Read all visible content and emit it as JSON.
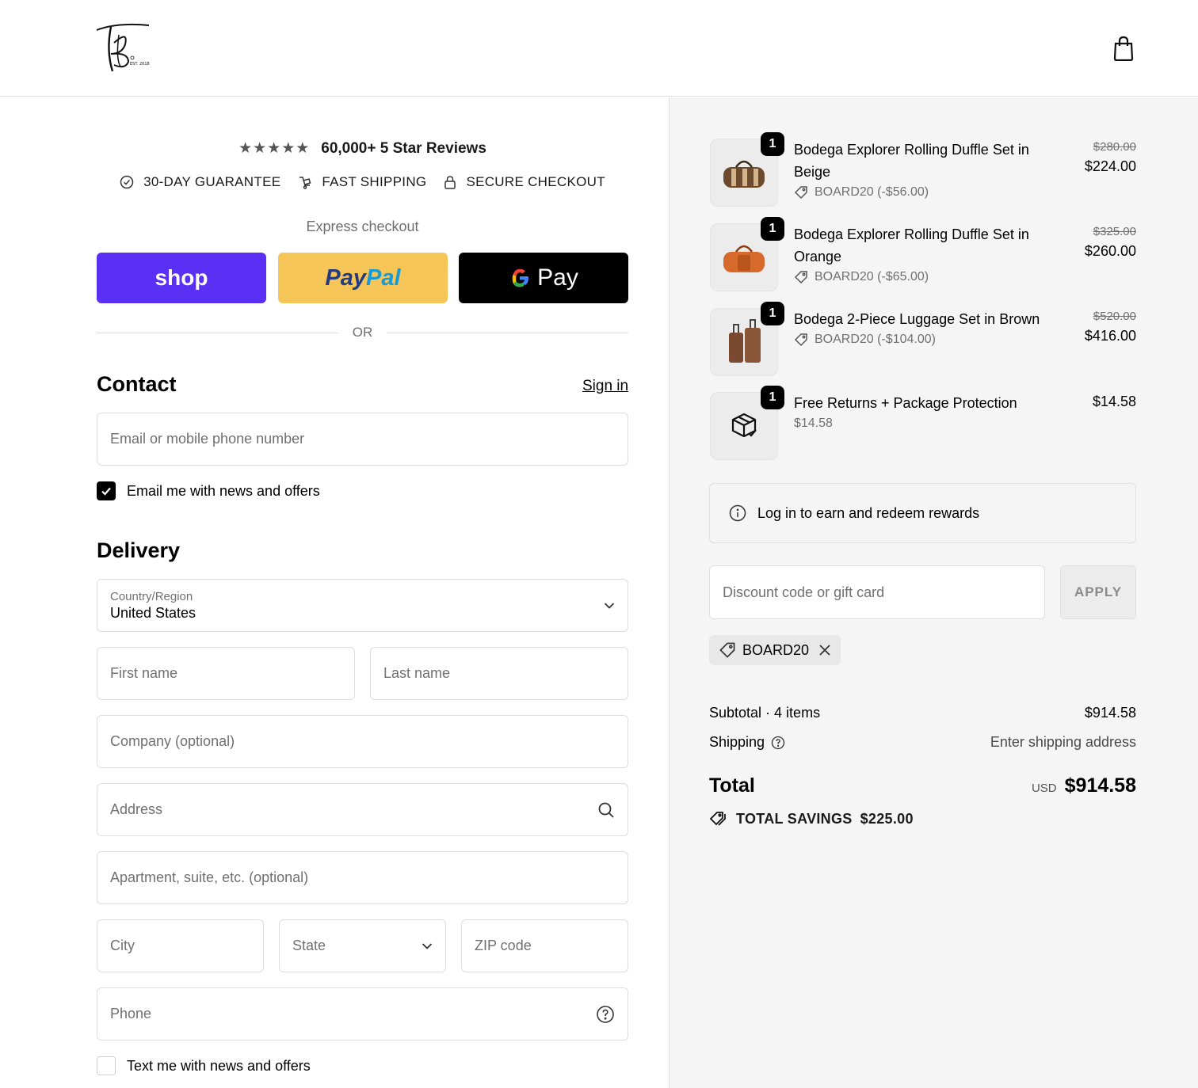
{
  "header": {
    "logo_alt": "TB EST. 2018",
    "cart_icon": "shopping-bag-icon"
  },
  "reviews": {
    "stars": "★★★★★",
    "text": "60,000+ 5 Star Reviews"
  },
  "trust": [
    {
      "icon": "check-circle-icon",
      "label": "30-DAY GUARANTEE"
    },
    {
      "icon": "shipping-icon",
      "label": "FAST SHIPPING"
    },
    {
      "icon": "lock-icon",
      "label": "SECURE CHECKOUT"
    }
  ],
  "express": {
    "title": "Express checkout",
    "shop_label": "shop",
    "paypal_label_1": "Pay",
    "paypal_label_2": "Pal",
    "gpay_label": "Pay",
    "or": "OR"
  },
  "contact": {
    "title": "Contact",
    "signin": "Sign in",
    "email_placeholder": "Email or mobile phone number",
    "email_news_label": "Email me with news and offers",
    "email_news_checked": true
  },
  "delivery": {
    "title": "Delivery",
    "country_label": "Country/Region",
    "country_value": "United States",
    "first_name": "First name",
    "last_name": "Last name",
    "company": "Company (optional)",
    "address": "Address",
    "apartment": "Apartment, suite, etc. (optional)",
    "city": "City",
    "state": "State",
    "zip": "ZIP code",
    "phone": "Phone",
    "text_news_label": "Text me with news and offers",
    "text_news_checked": false
  },
  "cart": {
    "items": [
      {
        "qty": "1",
        "name": "Bodega Explorer Rolling Duffle Set in Beige",
        "discount": "BOARD20 (-$56.00)",
        "old_price": "$280.00",
        "price": "$224.00"
      },
      {
        "qty": "1",
        "name": "Bodega Explorer Rolling Duffle Set in Orange",
        "discount": "BOARD20 (-$65.00)",
        "old_price": "$325.00",
        "price": "$260.00"
      },
      {
        "qty": "1",
        "name": "Bodega 2-Piece Luggage Set in Brown",
        "discount": "BOARD20 (-$104.00)",
        "old_price": "$520.00",
        "price": "$416.00"
      },
      {
        "qty": "1",
        "name": "Free Returns + Package Protection",
        "sub": "$14.58",
        "price": "$14.58"
      }
    ],
    "rewards": "Log in to earn and redeem rewards",
    "discount_placeholder": "Discount code or gift card",
    "apply": "APPLY",
    "applied_code": "BOARD20",
    "subtotal_label": "Subtotal · 4 items",
    "subtotal_value": "$914.58",
    "shipping_label": "Shipping",
    "shipping_value": "Enter shipping address",
    "total_label": "Total",
    "currency": "USD",
    "total_value": "$914.58",
    "savings_label": "TOTAL SAVINGS",
    "savings_value": "$225.00"
  }
}
